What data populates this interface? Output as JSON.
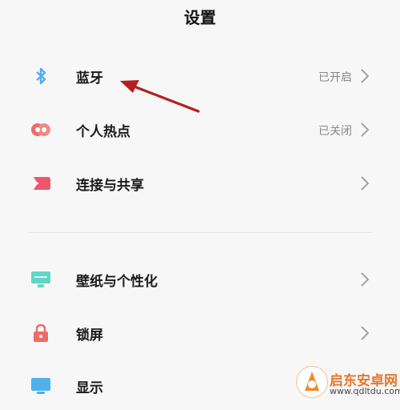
{
  "header": {
    "title": "设置"
  },
  "items": [
    {
      "label": "蓝牙",
      "status": "已开启",
      "icon": "bluetooth-icon",
      "color": "#5aa9f0"
    },
    {
      "label": "个人热点",
      "status": "已关闭",
      "icon": "hotspot-icon",
      "color": "#f06a6a"
    },
    {
      "label": "连接与共享",
      "status": "",
      "icon": "share-icon",
      "color": "#f0556e"
    },
    {
      "label": "壁纸与个性化",
      "status": "",
      "icon": "wallpaper-icon",
      "color": "#5fd7c2"
    },
    {
      "label": "锁屏",
      "status": "",
      "icon": "lock-icon",
      "color": "#f06a6a"
    },
    {
      "label": "显示",
      "status": "",
      "icon": "display-icon",
      "color": "#4fb0ea"
    }
  ],
  "annotation": {
    "arrow_color": "#b3211e"
  },
  "watermark": {
    "name": "启东安卓网",
    "url": "www.qdltdu.com"
  }
}
